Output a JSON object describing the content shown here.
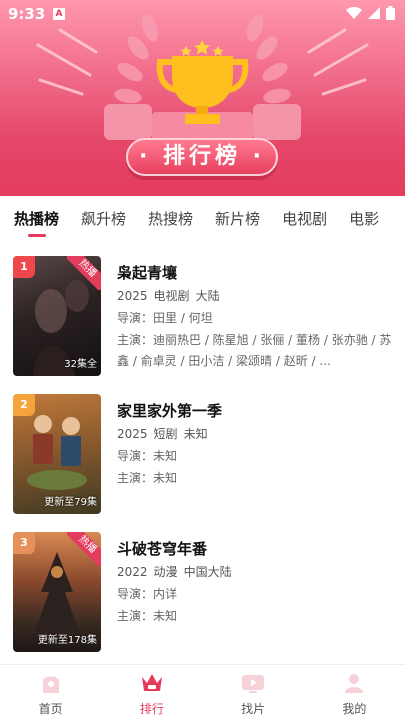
{
  "status_bar": {
    "time": "9:33",
    "a_badge": "A"
  },
  "header": {
    "banner_title": "· 排行榜 ·"
  },
  "tabs": [
    {
      "label": "热播榜",
      "active": true
    },
    {
      "label": "飙升榜"
    },
    {
      "label": "热搜榜"
    },
    {
      "label": "新片榜"
    },
    {
      "label": "电视剧"
    },
    {
      "label": "电影"
    }
  ],
  "items": [
    {
      "rank": "1",
      "hot_label": "热播",
      "poster_caption": "32集全",
      "title": "枭起青壤",
      "year": "2025",
      "type": "电视剧",
      "region": "大陆",
      "director": "导演：田里 / 何坦",
      "cast": "主演：迪丽热巴 / 陈星旭 / 张俪 / 董杨 / 张亦驰 / 苏鑫 / 俞卓灵 / 田小洁 / 梁颂晴 / 赵昕 / ..."
    },
    {
      "rank": "2",
      "hot_label": "",
      "poster_caption": "更新至79集",
      "title": "家里家外第一季",
      "year": "2025",
      "type": "短剧",
      "region": "未知",
      "director": "导演：未知",
      "cast": "主演：未知"
    },
    {
      "rank": "3",
      "hot_label": "热播",
      "poster_caption": "更新至178集",
      "title": "斗破苍穹年番",
      "year": "2022",
      "type": "动漫",
      "region": "中国大陆",
      "director": "导演：内详",
      "cast": "主演：未知"
    }
  ],
  "bottom_nav": [
    {
      "label": "首页",
      "icon": "home-icon"
    },
    {
      "label": "排行",
      "icon": "crown-icon",
      "active": true
    },
    {
      "label": "找片",
      "icon": "tv-icon"
    },
    {
      "label": "我的",
      "icon": "profile-icon"
    }
  ],
  "colors": {
    "accent": "#e33c5d",
    "rank1": "#f0484a",
    "rank2": "#f4a43a",
    "rank3": "#e7915a"
  }
}
